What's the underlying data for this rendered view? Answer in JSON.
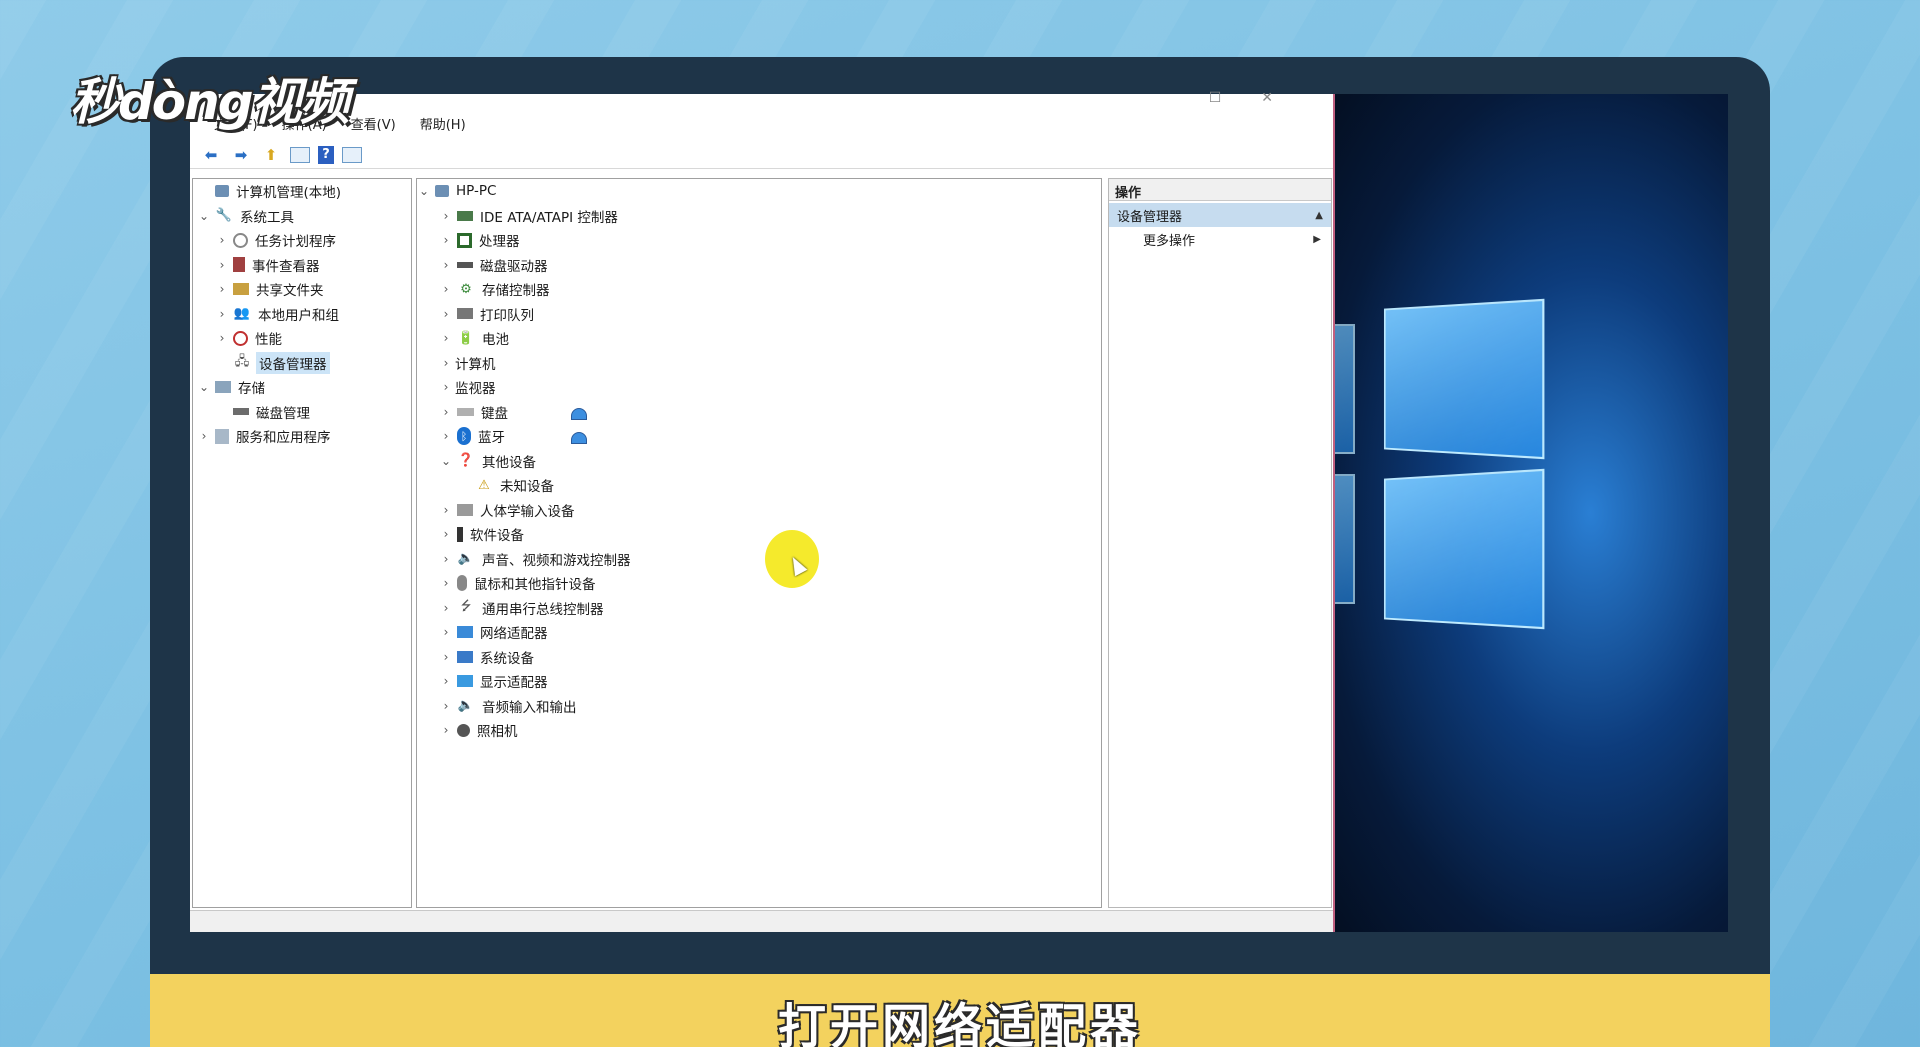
{
  "watermark": "秒dòng视频",
  "window": {
    "controls": {
      "maximize": "☐",
      "close": "✕"
    },
    "menu": [
      "文件(F)",
      "操作(A)",
      "查看(V)",
      "帮助(H)"
    ],
    "toolbar": [
      {
        "name": "back-icon",
        "glyph": "⬅"
      },
      {
        "name": "forward-icon",
        "glyph": "➡"
      },
      {
        "name": "up-folder-icon",
        "glyph": "⬆"
      },
      {
        "name": "show-hide-tree-icon",
        "glyph": ""
      },
      {
        "name": "help-icon",
        "glyph": "?"
      },
      {
        "name": "properties-icon",
        "glyph": ""
      }
    ]
  },
  "left_tree": [
    {
      "label": "计算机管理(本地)",
      "level": 0,
      "chev": "",
      "icon": "pc",
      "glyph": ""
    },
    {
      "label": "系统工具",
      "level": 0,
      "chev": "⌄",
      "icon": "tools",
      "glyph": "🔧"
    },
    {
      "label": "任务计划程序",
      "level": 1,
      "chev": "›",
      "icon": "clock",
      "glyph": ""
    },
    {
      "label": "事件查看器",
      "level": 1,
      "chev": "›",
      "icon": "log",
      "glyph": ""
    },
    {
      "label": "共享文件夹",
      "level": 1,
      "chev": "›",
      "icon": "share",
      "glyph": ""
    },
    {
      "label": "本地用户和组",
      "level": 1,
      "chev": "›",
      "icon": "users",
      "glyph": "👥"
    },
    {
      "label": "性能",
      "level": 1,
      "chev": "›",
      "icon": "perf",
      "glyph": ""
    },
    {
      "label": "设备管理器",
      "level": 1,
      "chev": "",
      "icon": "dev",
      "glyph": "🖧",
      "selected": true
    },
    {
      "label": "存储",
      "level": 0,
      "chev": "⌄",
      "icon": "store",
      "glyph": ""
    },
    {
      "label": "磁盘管理",
      "level": 1,
      "chev": "",
      "icon": "disk",
      "glyph": ""
    },
    {
      "label": "服务和应用程序",
      "level": 0,
      "chev": "›",
      "icon": "svc",
      "glyph": ""
    }
  ],
  "device_tree": {
    "root": "HP-PC",
    "items": [
      {
        "label": "IDE ATA/ATAPI 控制器",
        "chev": "›",
        "icon": "ide",
        "glyph": ""
      },
      {
        "label": "处理器",
        "chev": "›",
        "icon": "cpu",
        "glyph": ""
      },
      {
        "label": "磁盘驱动器",
        "chev": "›",
        "icon": "drive",
        "glyph": ""
      },
      {
        "label": "存储控制器",
        "chev": "›",
        "icon": "ctl",
        "glyph": "⚙"
      },
      {
        "label": "打印队列",
        "chev": "›",
        "icon": "print",
        "glyph": ""
      },
      {
        "label": "电池",
        "chev": "›",
        "icon": "batt",
        "glyph": "🔋"
      },
      {
        "label": "计算机",
        "chev": "›",
        "icon": "monitor",
        "glyph": ""
      },
      {
        "label": "监视器",
        "chev": "›",
        "icon": "monitor",
        "glyph": ""
      },
      {
        "label": "键盘",
        "chev": "›",
        "icon": "kbd",
        "glyph": ""
      },
      {
        "label": "蓝牙",
        "chev": "›",
        "icon": "bt",
        "glyph": "ᛒ"
      },
      {
        "label": "其他设备",
        "chev": "⌄",
        "icon": "other",
        "glyph": "❓"
      },
      {
        "label": "未知设备",
        "chev": "",
        "icon": "warn",
        "glyph": "⚠",
        "child": true
      },
      {
        "label": "人体学输入设备",
        "chev": "›",
        "icon": "hid",
        "glyph": ""
      },
      {
        "label": "软件设备",
        "chev": "›",
        "icon": "soft",
        "glyph": ""
      },
      {
        "label": "声音、视频和游戏控制器",
        "chev": "›",
        "icon": "audio",
        "glyph": "🔈"
      },
      {
        "label": "鼠标和其他指针设备",
        "chev": "›",
        "icon": "mouse",
        "glyph": ""
      },
      {
        "label": "通用串行总线控制器",
        "chev": "›",
        "icon": "usb",
        "glyph": "⭍"
      },
      {
        "label": "网络适配器",
        "chev": "›",
        "icon": "net",
        "glyph": ""
      },
      {
        "label": "系统设备",
        "chev": "›",
        "icon": "sys",
        "glyph": ""
      },
      {
        "label": "显示适配器",
        "chev": "›",
        "icon": "disp",
        "glyph": ""
      },
      {
        "label": "音频输入和输出",
        "chev": "›",
        "icon": "audio",
        "glyph": "🔈"
      },
      {
        "label": "照相机",
        "chev": "›",
        "icon": "cam",
        "glyph": ""
      }
    ]
  },
  "actions": {
    "header": "操作",
    "section": "设备管理器",
    "item": "更多操作"
  },
  "caption": "打开网络适配器"
}
